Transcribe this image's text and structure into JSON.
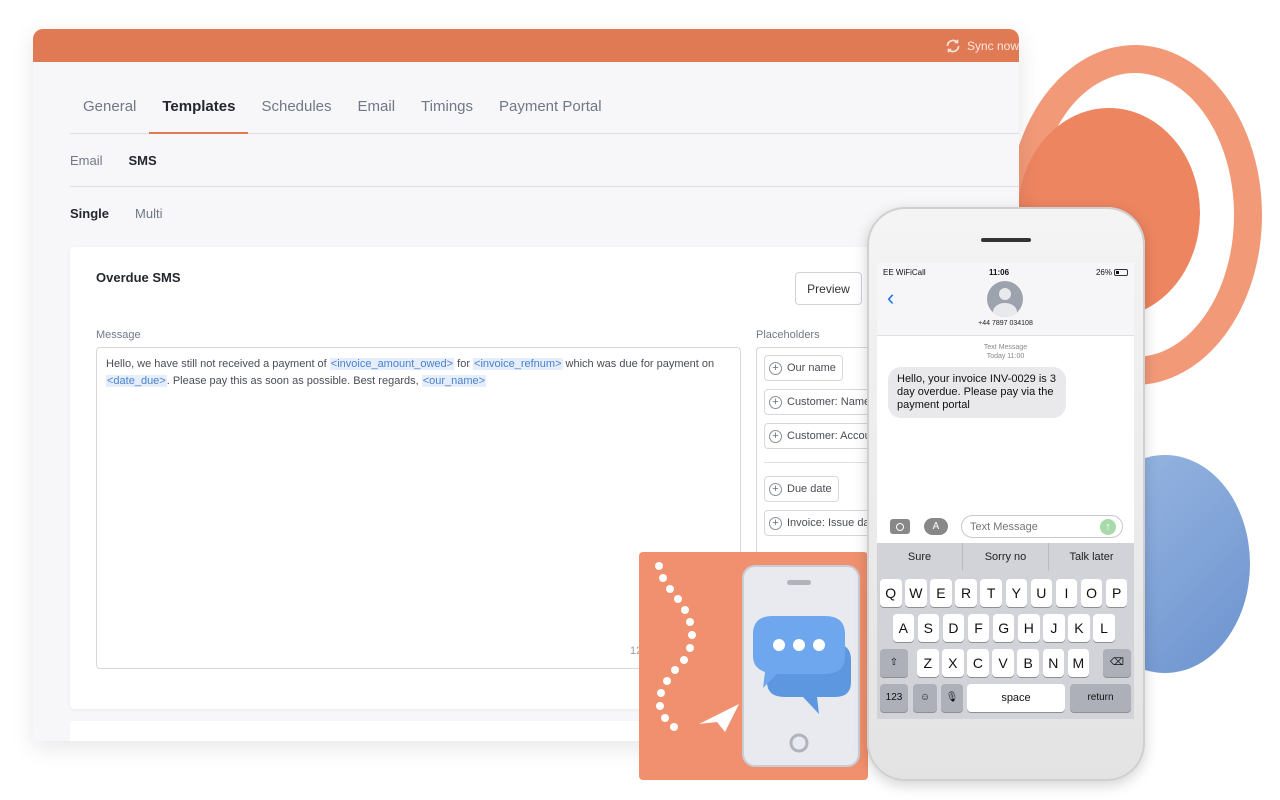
{
  "app": {
    "sync_label": "Sync now",
    "tabs": [
      {
        "label": "General"
      },
      {
        "label": "Templates"
      },
      {
        "label": "Schedules"
      },
      {
        "label": "Email"
      },
      {
        "label": "Timings"
      },
      {
        "label": "Payment Portal"
      }
    ],
    "active_tab": "Templates",
    "subtabs": [
      {
        "label": "Email"
      },
      {
        "label": "SMS"
      }
    ],
    "modes": [
      {
        "label": "Single"
      },
      {
        "label": "Multi"
      }
    ]
  },
  "template": {
    "title": "Overdue SMS",
    "preview_label": "Preview",
    "message_label": "Message",
    "message_parts": {
      "p1": "Hello, we have still not received a payment of ",
      "ph1": "<invoice_amount_owed>",
      "p2": " for ",
      "ph2": "<invoice_refnum>",
      "p3": " which was due for payment on ",
      "ph3": "<date_due>",
      "p4": ". Please pay this as soon as possible. Best regards, ",
      "ph4": "<our_name>"
    },
    "char_count": "12",
    "placeholders_label": "Placeholders",
    "placeholders": [
      {
        "label": "Our name"
      },
      {
        "label": "Customer: Name"
      },
      {
        "label": "Customer: Account"
      },
      {
        "label": "Due date"
      },
      {
        "label": "Invoice: Issue date"
      }
    ]
  },
  "phone": {
    "carrier": "EE WiFiCall",
    "time": "11:06",
    "battery": "26%",
    "contact_number": "+44 7897 034108",
    "thread_type": "Text Message",
    "thread_time": "Today 11:00",
    "message": "Hello, your invoice INV-0029 is 3 day overdue. Please pay via the payment portal",
    "compose_placeholder": "Text Message",
    "suggestions": [
      "Sure",
      "Sorry no",
      "Talk later"
    ],
    "keys": {
      "row1": [
        "Q",
        "W",
        "E",
        "R",
        "T",
        "Y",
        "U",
        "I",
        "O",
        "P"
      ],
      "row2": [
        "A",
        "S",
        "D",
        "F",
        "G",
        "H",
        "J",
        "K",
        "L"
      ],
      "row3": [
        "Z",
        "X",
        "C",
        "V",
        "B",
        "N",
        "M"
      ],
      "numbers": "123",
      "space": "space",
      "return": "return"
    }
  },
  "colors": {
    "brand": "#e07a55",
    "promo": "#f0906e",
    "chat_blue": "#6ea7ee",
    "placeholder_text": "#4a82cf"
  }
}
